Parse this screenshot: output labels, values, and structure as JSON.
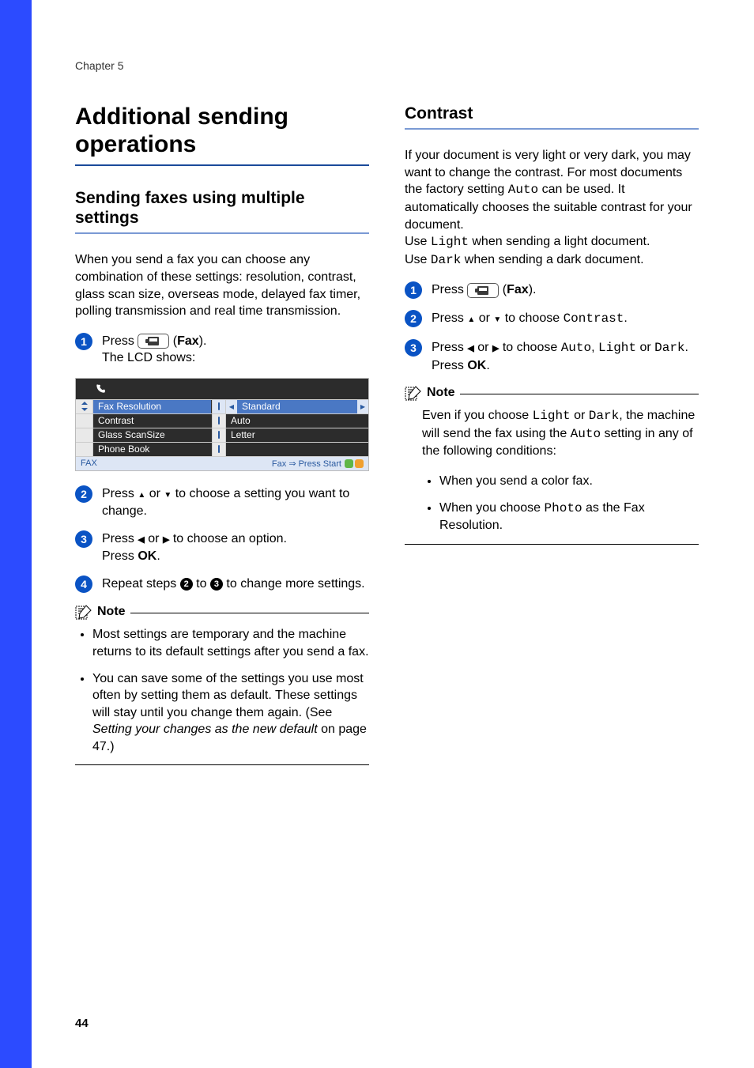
{
  "chapter": "Chapter 5",
  "page_number": "44",
  "left": {
    "h1": "Additional sending operations",
    "h2": "Sending faxes using multiple settings",
    "intro": "When you send a fax you can choose any combination of these settings: resolution, contrast, glass scan size, overseas mode, delayed fax timer, polling transmission and real time transmission.",
    "step1_press": "Press ",
    "step1_fax": "Fax",
    "step1_after": "The LCD shows:",
    "lcd": {
      "rows": [
        {
          "label": "Fax Resolution",
          "value": "Standard",
          "selected": true
        },
        {
          "label": "Contrast",
          "value": "Auto",
          "selected": false
        },
        {
          "label": "Glass ScanSize",
          "value": "Letter",
          "selected": false
        },
        {
          "label": "Phone Book",
          "value": "",
          "selected": false
        }
      ],
      "footer_left": "FAX",
      "footer_right": "Fax ⇒ Press Start"
    },
    "step2_a": "Press ",
    "step2_b": " or ",
    "step2_c": " to choose a setting you want to change.",
    "step3_a": "Press ",
    "step3_b": " or ",
    "step3_c": " to choose an option.",
    "step3_d": "Press ",
    "step3_ok": "OK",
    "step4_a": "Repeat steps ",
    "step4_b": " to ",
    "step4_c": " to change more settings.",
    "note_label": "Note",
    "note1": "Most settings are temporary and the machine returns to its default settings after you send a fax.",
    "note2_a": "You can save some of the settings you use most often by setting them as default. These settings will stay until you change them again. (See ",
    "note2_i": "Setting your changes as the new default",
    "note2_b": " on page 47.)"
  },
  "right": {
    "h2": "Contrast",
    "p1_a": "If your document is very light or very dark, you may want to change the contrast. For most documents the factory setting ",
    "p1_auto": "Auto",
    "p1_b": " can be used. It automatically chooses the suitable contrast for your document.",
    "p2_a": "Use ",
    "p2_light": "Light",
    "p2_b": " when sending a light document.",
    "p3_a": "Use ",
    "p3_dark": "Dark",
    "p3_b": " when sending a dark document.",
    "step1_press": "Press ",
    "step1_fax": "Fax",
    "step2_a": "Press ",
    "step2_b": " or ",
    "step2_c": " to choose ",
    "step2_contrast": "Contrast",
    "step3_a": "Press ",
    "step3_b": " or ",
    "step3_c": " to choose ",
    "step3_auto": "Auto",
    "step3_light": "Light",
    "step3_or": " or ",
    "step3_dark": "Dark",
    "step3_press": "Press ",
    "step3_ok": "OK",
    "note_label": "Note",
    "note_p_a": "Even if you choose ",
    "note_p_light": "Light",
    "note_p_b": " or ",
    "note_p_dark": "Dark",
    "note_p_c": ", the machine will send the fax using the ",
    "note_p_auto": "Auto",
    "note_p_d": " setting in any of the following conditions:",
    "note_li1": "When you send a color fax.",
    "note_li2_a": "When you choose ",
    "note_li2_photo": "Photo",
    "note_li2_b": " as the Fax Resolution."
  }
}
